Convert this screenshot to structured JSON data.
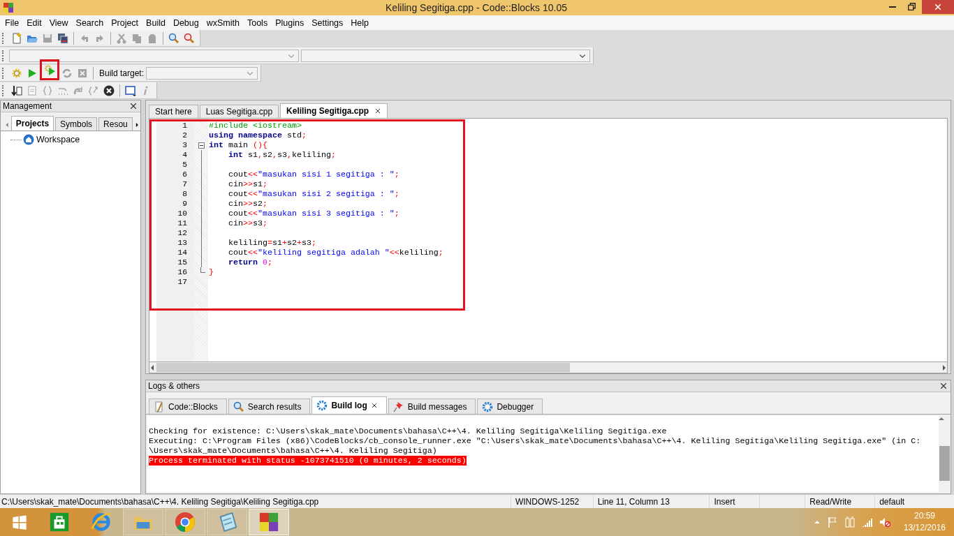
{
  "window": {
    "title": "Keliling Segitiga.cpp - Code::Blocks 10.05"
  },
  "menu": [
    "File",
    "Edit",
    "View",
    "Search",
    "Project",
    "Build",
    "Debug",
    "wxSmith",
    "Tools",
    "Plugins",
    "Settings",
    "Help"
  ],
  "main_toolbar": {
    "groups": [
      [
        {
          "disabled": false
        },
        {
          "disabled": false
        },
        {
          "disabled": true
        },
        {
          "disabled": false
        }
      ],
      [
        {
          "disabled": true
        },
        {
          "disabled": true
        }
      ],
      [
        {
          "disabled": true
        },
        {
          "disabled": true
        },
        {
          "disabled": true
        }
      ],
      [
        {
          "disabled": false
        },
        {
          "disabled": false
        }
      ]
    ]
  },
  "build_toolbar": {
    "tools": [
      {
        "disabled": false,
        "highlighted": false
      },
      {
        "disabled": false,
        "highlighted": false
      },
      {
        "disabled": false,
        "highlighted": true
      },
      {
        "disabled": true,
        "highlighted": false
      },
      {
        "disabled": true,
        "highlighted": false
      }
    ],
    "target_label": "Build target:"
  },
  "debug_toolbar": {
    "groups": [
      [
        {
          "disabled": false
        },
        {
          "disabled": true
        },
        {
          "disabled": true
        },
        {
          "disabled": true
        },
        {
          "disabled": true
        },
        {
          "disabled": true
        },
        {
          "disabled": false
        }
      ],
      [
        {
          "disabled": false
        },
        {
          "disabled": true
        }
      ]
    ]
  },
  "management": {
    "title": "Management",
    "tabs": [
      {
        "label": "Projects",
        "selected": true
      },
      {
        "label": "Symbols",
        "selected": false
      },
      {
        "label": "Resou",
        "selected": false
      }
    ],
    "tree": [
      {
        "label": "Workspace"
      }
    ]
  },
  "editor": {
    "tabs": [
      {
        "label": "Start here",
        "selected": false
      },
      {
        "label": "Luas Segitiga.cpp",
        "selected": false
      },
      {
        "label": "Keliling Segitiga.cpp",
        "selected": true
      }
    ],
    "highlighted": true,
    "lines": [
      {
        "number": "1",
        "kind": "plain",
        "indented": false,
        "tokens": [
          {
            "text": "#include <iostream>",
            "kind": "pre"
          }
        ]
      },
      {
        "number": "2",
        "kind": "plain",
        "indented": false,
        "tokens": [
          {
            "text": "using namespace",
            "kind": "kw"
          },
          {
            "text": " std",
            "kind": "plain"
          },
          {
            "text": ";",
            "kind": "op"
          }
        ]
      },
      {
        "number": "3",
        "kind": "fold-start",
        "expanded": true,
        "indented": false,
        "tokens": [
          {
            "text": "int",
            "kind": "kw"
          },
          {
            "text": " main ",
            "kind": "plain"
          },
          {
            "text": "(){",
            "kind": "op"
          }
        ]
      },
      {
        "number": "4",
        "kind": "fold-body",
        "indented": true,
        "tokens": [
          {
            "text": "int",
            "kind": "kw"
          },
          {
            "text": " s1",
            "kind": "plain"
          },
          {
            "text": ",",
            "kind": "op"
          },
          {
            "text": "s2",
            "kind": "plain"
          },
          {
            "text": ",",
            "kind": "op"
          },
          {
            "text": "s3",
            "kind": "plain"
          },
          {
            "text": ",",
            "kind": "op"
          },
          {
            "text": "keliling",
            "kind": "plain"
          },
          {
            "text": ";",
            "kind": "op"
          }
        ]
      },
      {
        "number": "5",
        "kind": "fold-body"
      },
      {
        "number": "6",
        "kind": "fold-body",
        "indented": true,
        "tokens": [
          {
            "text": "cout",
            "kind": "plain"
          },
          {
            "text": "<<",
            "kind": "op"
          },
          {
            "text": "\"masukan sisi 1 segitiga : \"",
            "kind": "str"
          },
          {
            "text": ";",
            "kind": "op"
          }
        ]
      },
      {
        "number": "7",
        "kind": "fold-body",
        "indented": true,
        "tokens": [
          {
            "text": "cin",
            "kind": "plain"
          },
          {
            "text": ">>",
            "kind": "op"
          },
          {
            "text": "s1",
            "kind": "plain"
          },
          {
            "text": ";",
            "kind": "op"
          }
        ]
      },
      {
        "number": "8",
        "kind": "fold-body",
        "indented": true,
        "tokens": [
          {
            "text": "cout",
            "kind": "plain"
          },
          {
            "text": "<<",
            "kind": "op"
          },
          {
            "text": "\"masukan sisi 2 segitiga : \"",
            "kind": "str"
          },
          {
            "text": ";",
            "kind": "op"
          }
        ]
      },
      {
        "number": "9",
        "kind": "fold-body",
        "indented": true,
        "tokens": [
          {
            "text": "cin",
            "kind": "plain"
          },
          {
            "text": ">>",
            "kind": "op"
          },
          {
            "text": "s2",
            "kind": "plain"
          },
          {
            "text": ";",
            "kind": "op"
          }
        ]
      },
      {
        "number": "10",
        "kind": "fold-body",
        "indented": true,
        "tokens": [
          {
            "text": "cout",
            "kind": "plain"
          },
          {
            "text": "<<",
            "kind": "op"
          },
          {
            "text": "\"masukan sisi 3 segitiga : \"",
            "kind": "str"
          },
          {
            "text": ";",
            "kind": "op"
          }
        ]
      },
      {
        "number": "11",
        "kind": "fold-body",
        "indented": true,
        "tokens": [
          {
            "text": "cin",
            "kind": "plain"
          },
          {
            "text": ">>",
            "kind": "op"
          },
          {
            "text": "s3",
            "kind": "plain"
          },
          {
            "text": ";",
            "kind": "op"
          }
        ]
      },
      {
        "number": "12",
        "kind": "fold-body"
      },
      {
        "number": "13",
        "kind": "fold-body",
        "indented": true,
        "tokens": [
          {
            "text": "keliling",
            "kind": "plain"
          },
          {
            "text": "=",
            "kind": "op"
          },
          {
            "text": "s1",
            "kind": "plain"
          },
          {
            "text": "+",
            "kind": "op"
          },
          {
            "text": "s2",
            "kind": "plain"
          },
          {
            "text": "+",
            "kind": "op"
          },
          {
            "text": "s3",
            "kind": "plain"
          },
          {
            "text": ";",
            "kind": "op"
          }
        ]
      },
      {
        "number": "14",
        "kind": "fold-body",
        "indented": true,
        "tokens": [
          {
            "text": "cout",
            "kind": "plain"
          },
          {
            "text": "<<",
            "kind": "op"
          },
          {
            "text": "\"keliling segitiga adalah \"",
            "kind": "str"
          },
          {
            "text": "<<",
            "kind": "op"
          },
          {
            "text": "keliling",
            "kind": "plain"
          },
          {
            "text": ";",
            "kind": "op"
          }
        ]
      },
      {
        "number": "15",
        "kind": "fold-body",
        "indented": true,
        "tokens": [
          {
            "text": "return ",
            "kind": "kw"
          },
          {
            "text": "0",
            "kind": "num"
          },
          {
            "text": ";",
            "kind": "op"
          }
        ]
      },
      {
        "number": "16",
        "kind": "fold-end",
        "indented": false,
        "tokens": [
          {
            "text": "}",
            "kind": "op"
          }
        ]
      },
      {
        "number": "17",
        "kind": "plain"
      }
    ]
  },
  "logs": {
    "title": "Logs & others",
    "tabs": [
      {
        "label": "Code::Blocks",
        "selected": false
      },
      {
        "label": "Search results",
        "selected": false
      },
      {
        "label": "Build log",
        "selected": true
      },
      {
        "label": "Build messages",
        "selected": false
      },
      {
        "label": "Debugger",
        "selected": false
      }
    ],
    "lines": [
      {
        "text": "Checking for existence: C:\\Users\\skak_mate\\Documents\\bahasa\\C++\\4. Keliling Segitiga\\Keliling Segitiga.exe",
        "kind": "info"
      },
      {
        "text": "Executing: C:\\Program Files (x86)\\CodeBlocks/cb_console_runner.exe \"C:\\Users\\skak_mate\\Documents\\bahasa\\C++\\4. Keliling Segitiga\\Keliling Segitiga.exe\" (in C:",
        "kind": "info"
      },
      {
        "text": "\\Users\\skak_mate\\Documents\\bahasa\\C++\\4. Keliling Segitiga)",
        "kind": "info"
      },
      {
        "text": "Process terminated with status -1073741510 (0 minutes, 2 seconds)",
        "kind": "error"
      }
    ]
  },
  "status_bar": {
    "path": "C:\\Users\\skak_mate\\Documents\\bahasa\\C++\\4. Keliling Segitiga\\Keliling Segitiga.cpp",
    "encoding": "WINDOWS-1252",
    "position": "Line 11, Column 13",
    "mode": "Insert",
    "access": "Read/Write",
    "profile": "default"
  },
  "taskbar": {
    "apps": [
      {
        "running": false,
        "active": false
      },
      {
        "running": false,
        "active": false
      },
      {
        "running": true,
        "active": false
      },
      {
        "running": true,
        "active": false
      },
      {
        "running": true,
        "active": false
      },
      {
        "running": true,
        "active": true
      }
    ],
    "time": "20:59",
    "date": "13/12/2016"
  }
}
